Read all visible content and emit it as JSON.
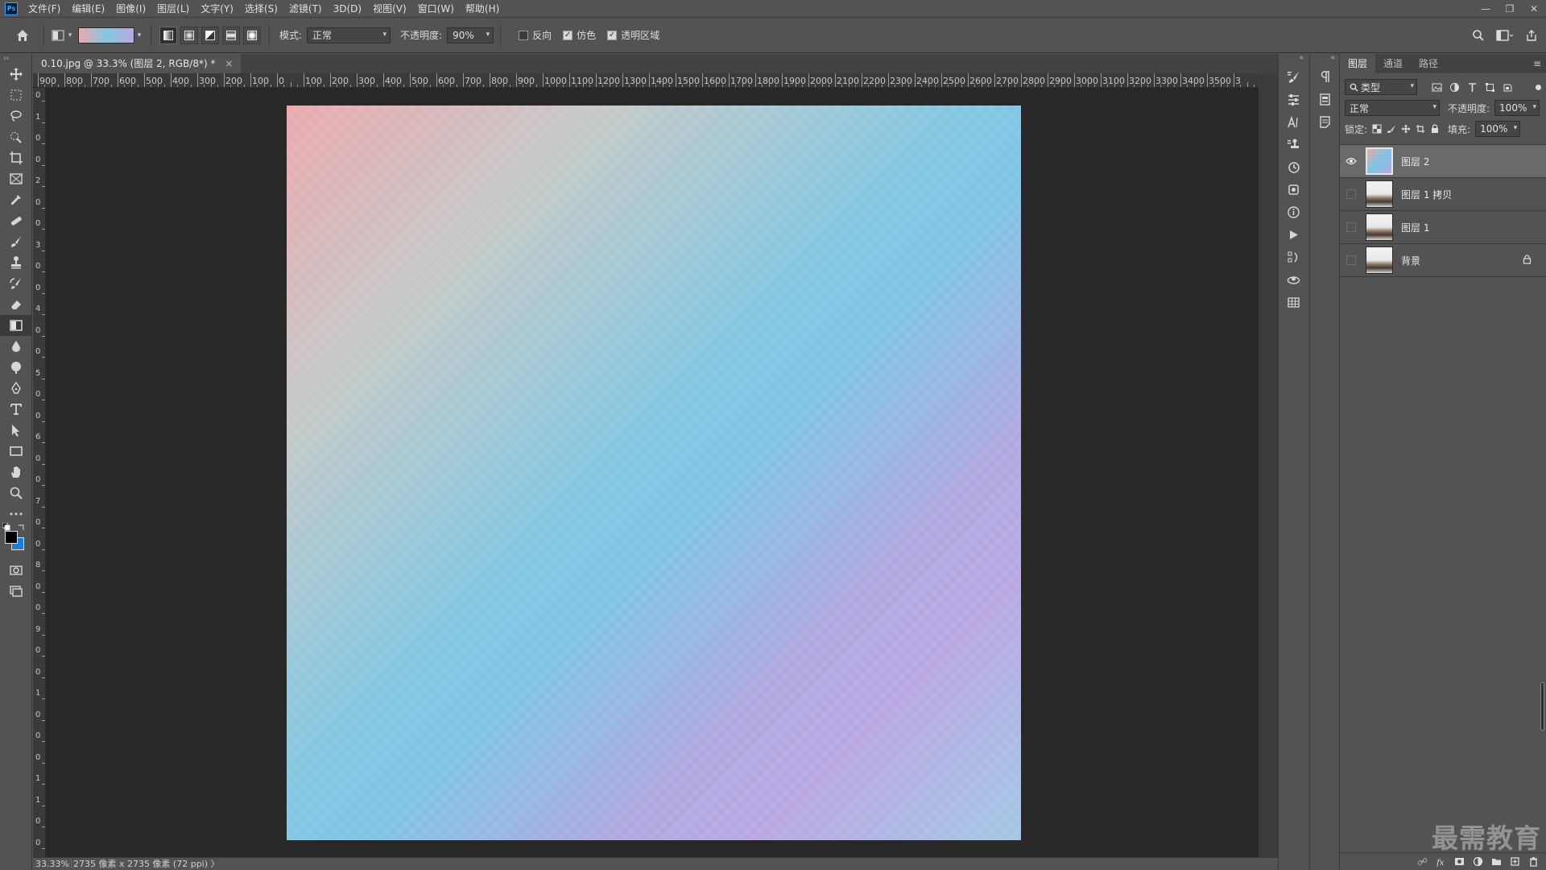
{
  "menubar": {
    "logo": "Ps",
    "items": [
      "文件(F)",
      "编辑(E)",
      "图像(I)",
      "图层(L)",
      "文字(Y)",
      "选择(S)",
      "滤镜(T)",
      "3D(D)",
      "视图(V)",
      "窗口(W)",
      "帮助(H)"
    ],
    "window_controls": {
      "minimize": "—",
      "restore": "❐",
      "close": "✕"
    }
  },
  "options": {
    "mode_label": "模式:",
    "mode_value": "正常",
    "opacity_label": "不透明度:",
    "opacity_value": "90%",
    "reverse_label": "反向",
    "reverse_checked": false,
    "dither_label": "仿色",
    "dither_checked": true,
    "transparency_label": "透明区域",
    "transparency_checked": true,
    "gradient_colors": [
      "#eaa9ae",
      "#86c7e0",
      "#b9a8e2"
    ]
  },
  "document": {
    "tab_title": "0.10.jpg @ 33.3% (图层 2, RGB/8*) *",
    "tab_close": "×",
    "ruler_h_labels": [
      "900",
      "800",
      "700",
      "600",
      "500",
      "400",
      "300",
      "200",
      "100",
      "0",
      "100",
      "200",
      "300",
      "400",
      "500",
      "600",
      "700",
      "800",
      "900",
      "1000",
      "1100",
      "1200",
      "1300",
      "1400",
      "1500",
      "1600",
      "1700",
      "1800",
      "1900",
      "2000",
      "2100",
      "2200",
      "2300",
      "2400",
      "2500",
      "2600",
      "2700",
      "2800",
      "2900",
      "3000",
      "3100",
      "3200",
      "3300",
      "3400",
      "3500",
      "3"
    ],
    "ruler_v_labels": [
      "0",
      "1",
      "0",
      "0",
      "2",
      "0",
      "0",
      "3",
      "0",
      "0",
      "4",
      "0",
      "0",
      "5",
      "0",
      "0",
      "6",
      "0",
      "0",
      "7",
      "0",
      "0",
      "8",
      "0",
      "0",
      "9",
      "0",
      "0",
      "1",
      "0",
      "0",
      "0",
      "1",
      "1",
      "0",
      "0"
    ],
    "canvas_background": "#282828"
  },
  "status": {
    "zoom": "33.33%",
    "doc_info": "2735 像素 x 2735 像素 (72 ppi)",
    "arrow": "〉"
  },
  "layers_panel": {
    "tabs": [
      "图层",
      "通道",
      "路径"
    ],
    "active_tab": "图层",
    "menu_icon": "≡",
    "filter_label": "类型",
    "blend_mode": "正常",
    "opacity_label": "不透明度:",
    "opacity_value": "100%",
    "lock_label": "锁定:",
    "fill_label": "填充:",
    "fill_value": "100%",
    "layers": [
      {
        "name": "图层 2",
        "visible": true,
        "selected": true,
        "thumb": "gradient"
      },
      {
        "name": "图层 1 拷贝",
        "visible": false,
        "selected": false,
        "thumb": "photo"
      },
      {
        "name": "图层 1",
        "visible": false,
        "selected": false,
        "thumb": "photo"
      },
      {
        "name": "背景",
        "visible": false,
        "selected": false,
        "thumb": "photo",
        "locked": true
      }
    ]
  },
  "watermark": "最需教育",
  "icons": {
    "home": "home-icon",
    "search": "search-icon",
    "workspace": "workspace-icon",
    "share": "share-icon"
  }
}
